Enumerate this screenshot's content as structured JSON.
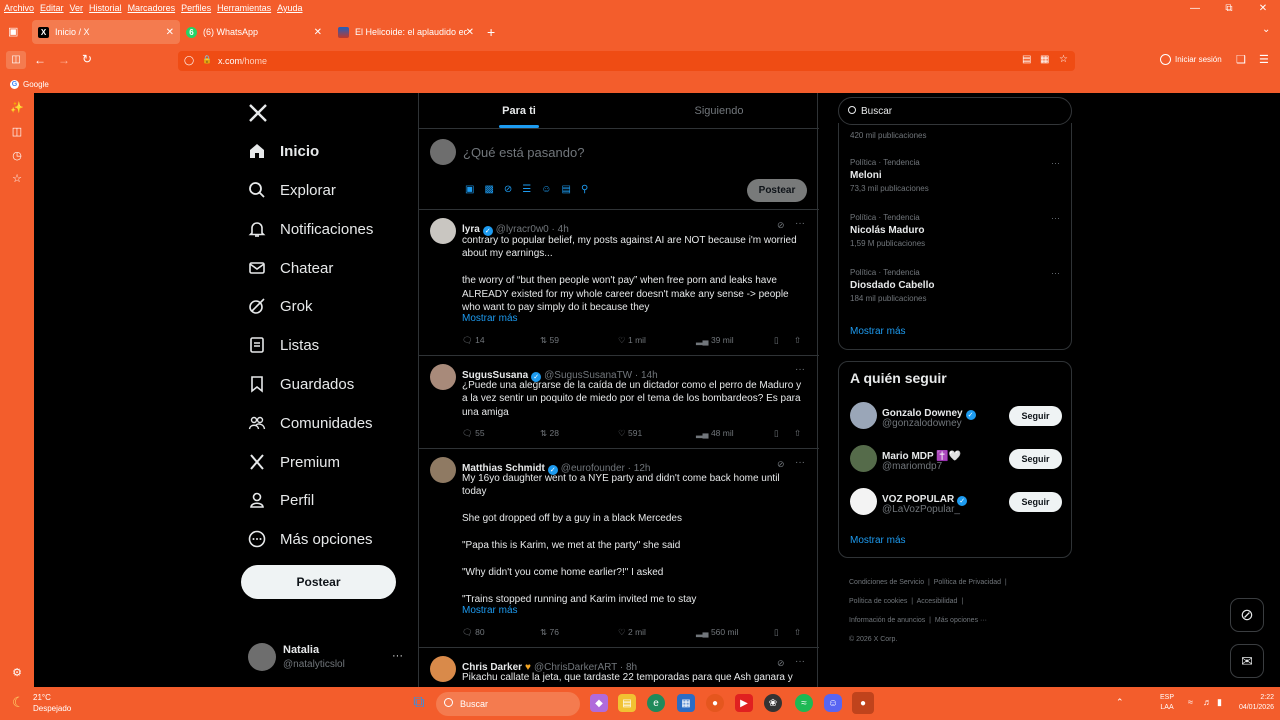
{
  "menubar": [
    "Archivo",
    "Editar",
    "Ver",
    "Historial",
    "Marcadores",
    "Perfiles",
    "Herramientas",
    "Ayuda"
  ],
  "tabs": [
    {
      "title": "Inicio / X",
      "fav": "X",
      "color": "#000000"
    },
    {
      "title": "(6) WhatsApp",
      "fav": "6",
      "color": "#25d366"
    },
    {
      "title": "El Helicoide: el aplaudido edific",
      "fav": "",
      "color": "#c0392b"
    }
  ],
  "url": {
    "host": "x.com",
    "path": "/home"
  },
  "account": {
    "signin": "Iniciar sesión"
  },
  "bookmarks": {
    "google": "Google"
  },
  "nav": {
    "items": [
      {
        "label": "Inicio",
        "icon": "home-icon"
      },
      {
        "label": "Explorar",
        "icon": "search-icon"
      },
      {
        "label": "Notificaciones",
        "icon": "bell-icon"
      },
      {
        "label": "Chatear",
        "icon": "mail-icon"
      },
      {
        "label": "Grok",
        "icon": "grok-icon"
      },
      {
        "label": "Listas",
        "icon": "list-icon"
      },
      {
        "label": "Guardados",
        "icon": "bookmark-icon"
      },
      {
        "label": "Comunidades",
        "icon": "communities-icon"
      },
      {
        "label": "Premium",
        "icon": "x-logo-icon"
      },
      {
        "label": "Perfil",
        "icon": "person-icon"
      },
      {
        "label": "Más opciones",
        "icon": "more-circle-icon"
      }
    ],
    "post": "Postear",
    "user": {
      "name": "Natalia",
      "handle": "@natalyticslol"
    }
  },
  "feed": {
    "tabs": [
      "Para ti",
      "Siguiendo"
    ],
    "composer": {
      "placeholder": "¿Qué está pasando?",
      "post": "Postear"
    },
    "tweets": [
      {
        "name": "lyra",
        "handle": "@lyracr0w0",
        "time": "4h",
        "verified": true,
        "text": "contrary to popular belief, my posts against AI are NOT because i'm worried\nabout my earnings...\n\nthe worry of “but then people won't pay” when free porn and leaks have\nALREADY existed for my whole career doesn't make any sense -> people\nwho want to pay simply do it because they",
        "more": "Mostrar más",
        "replies": "14",
        "reposts": "59",
        "likes": "1 mil",
        "views": "39 mil"
      },
      {
        "name": "SugusSusana",
        "handle": "@SugusSusanaTW",
        "time": "14h",
        "verified": true,
        "text": "¿Puede una alegrarse de la caída de un dictador como el perro de Maduro y\na la vez sentir un poquito de miedo por el tema de los bombardeos? Es para\nuna amiga",
        "more": "",
        "replies": "55",
        "reposts": "28",
        "likes": "591",
        "views": "48 mil"
      },
      {
        "name": "Matthias Schmidt",
        "handle": "@eurofounder",
        "time": "12h",
        "verified": true,
        "text": "My 16yo daughter went to a NYE party and didn't come back home until\ntoday\n\nShe got dropped off by a guy in a black Mercedes\n\n\"Papa this is Karim, we met at the party\" she said\n\n\"Why didn't you come home earlier?!\" I asked\n\n\"Trains stopped running and Karim invited me to stay",
        "more": "Mostrar más",
        "replies": "80",
        "reposts": "76",
        "likes": "2 mil",
        "views": "560 mil"
      },
      {
        "name": "Chris Darker",
        "handle": "@ChrisDarkerART",
        "time": "8h",
        "verified": false,
        "text": "Pikachu callate la jeta, que tardaste 22 temporadas para que Ash ganara y",
        "more": "",
        "replies": "",
        "reposts": "",
        "likes": "",
        "views": ""
      }
    ]
  },
  "search": {
    "placeholder": "Buscar"
  },
  "trends": {
    "top_count": "420 mil publicaciones",
    "items": [
      {
        "meta": "Política · Tendencia",
        "name": "Meloni",
        "count": "73,3 mil publicaciones"
      },
      {
        "meta": "Política · Tendencia",
        "name": "Nicolás Maduro",
        "count": "1,59 M publicaciones"
      },
      {
        "meta": "Política · Tendencia",
        "name": "Diosdado Cabello",
        "count": "184 mil publicaciones"
      }
    ],
    "more": "Mostrar más"
  },
  "follow": {
    "title": "A quién seguir",
    "users": [
      {
        "name": "Gonzalo Downey",
        "handle": "@gonzalodowney",
        "verified": true
      },
      {
        "name": "Mario MDP ✝️🤍",
        "handle": "@mariomdp7",
        "verified": false
      },
      {
        "name": "VOZ POPULAR",
        "handle": "@LaVozPopular_",
        "verified": true
      }
    ],
    "button": "Seguir",
    "more": "Mostrar más"
  },
  "footer": {
    "row1": [
      "Condiciones de Servicio",
      "Política de Privacidad"
    ],
    "row2": [
      "Política de cookies",
      "Accesibilidad"
    ],
    "row3": [
      "Información de anuncios",
      "Más opciones ···"
    ],
    "copyright": "© 2026 X Corp."
  },
  "taskbar": {
    "weather": {
      "temp": "21°C",
      "desc": "Despejado"
    },
    "search": "Buscar",
    "lang": {
      "l1": "ESP",
      "l2": "LAA"
    },
    "clock": {
      "time": "2:22",
      "date": "04/01/2026"
    }
  },
  "colors": {
    "browser": "#f35d2c",
    "accent": "#1d9bf0",
    "bg": "#000000"
  }
}
